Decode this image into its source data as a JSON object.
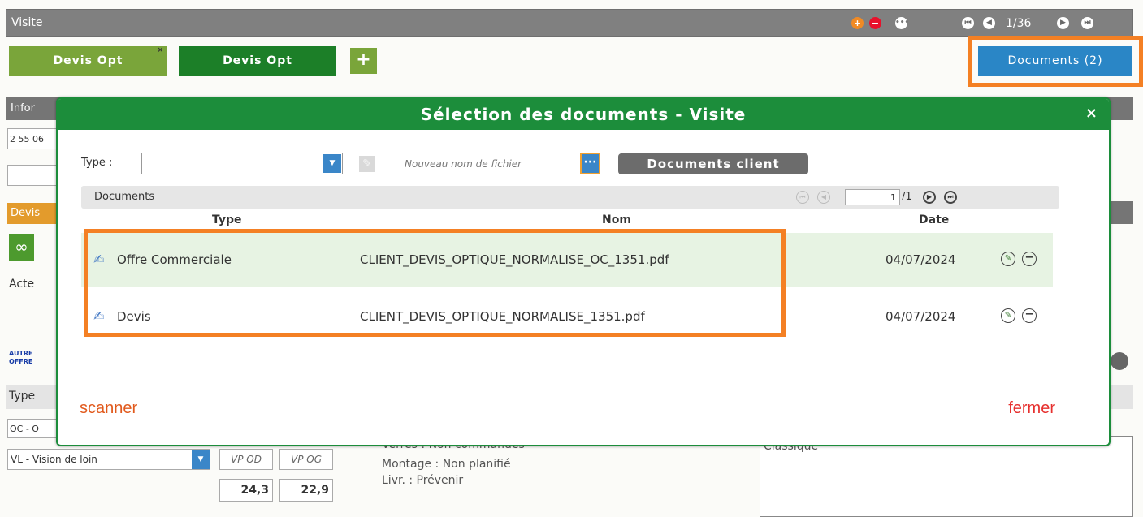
{
  "window": {
    "title": "Visite",
    "pager": "1/36"
  },
  "tabs": [
    {
      "label": "Devis Opt",
      "close": "×"
    },
    {
      "label": "Devis Opt"
    }
  ],
  "add_tab_label": "+",
  "documents_button": "Documents (2)",
  "background": {
    "info_label": "Infor",
    "field1": "2 55 06",
    "devis_label": "Devis",
    "acte_label": "Acte",
    "autre_offre": "AUTRE OFFRE",
    "type_label": "Type",
    "oc_value": "OC - O",
    "vision_select": "VL - Vision de loin",
    "vp_od": "VP OD",
    "vp_og": "VP OG",
    "val_od": "24,3",
    "val_og": "22,9",
    "verres": "Verres : Non commandés",
    "montage": "Montage : Non planifié",
    "livraison": "Livr. : Prévenir",
    "notes": "Classique"
  },
  "modal": {
    "title": "Sélection des documents - Visite",
    "close": "×",
    "type_label": "Type :",
    "type_value": "",
    "filename_placeholder": "Nouveau nom de fichier",
    "browse_label": "···",
    "client_docs_button": "Documents client",
    "docs_section_label": "Documents",
    "page_input": "1",
    "page_total": "/1",
    "columns": {
      "type": "Type",
      "name": "Nom",
      "date": "Date"
    },
    "rows": [
      {
        "type": "Offre Commerciale",
        "name": "CLIENT_DEVIS_OPTIQUE_NORMALISE_OC_1351.pdf",
        "date": "04/07/2024"
      },
      {
        "type": "Devis",
        "name": "CLIENT_DEVIS_OPTIQUE_NORMALISE_1351.pdf",
        "date": "04/07/2024"
      }
    ],
    "scanner_link": "scanner",
    "close_link": "fermer"
  },
  "colors": {
    "modal_green": "#1c8d3b",
    "highlight_orange": "#f48024",
    "docs_blue": "#2a86c6"
  }
}
